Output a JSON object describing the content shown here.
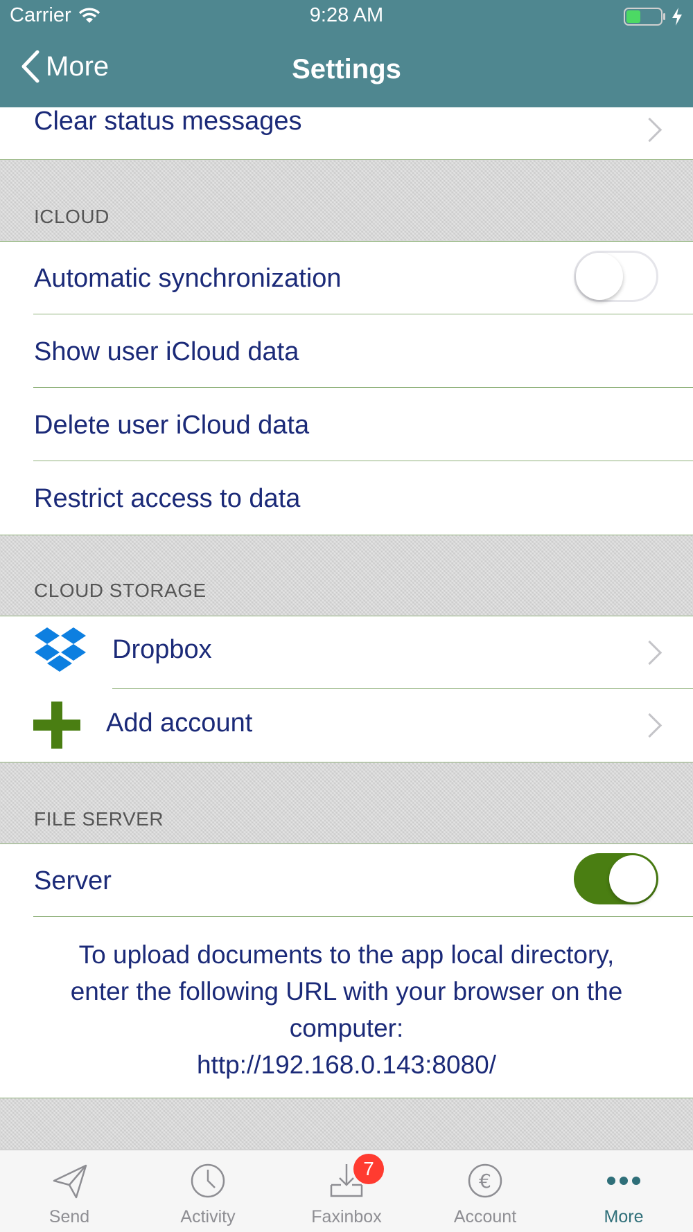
{
  "status_bar": {
    "carrier": "Carrier",
    "time": "9:28 AM"
  },
  "nav": {
    "back_label": "More",
    "title": "Settings"
  },
  "rows": {
    "clear_status": "Clear status messages"
  },
  "icloud": {
    "header": "ICLOUD",
    "auto_sync": {
      "label": "Automatic synchronization",
      "enabled": false
    },
    "show_data": "Show user iCloud data",
    "delete_data": "Delete user iCloud data",
    "restrict_access": "Restrict access to data"
  },
  "cloud_storage": {
    "header": "CLOUD STORAGE",
    "dropbox": "Dropbox",
    "add_account": "Add account"
  },
  "file_server": {
    "header": "FILE SERVER",
    "server": {
      "label": "Server",
      "enabled": true
    },
    "info_line1": "To upload documents to the app local directory,",
    "info_line2": "enter the following URL with your browser on the",
    "info_line3": "computer:",
    "url": "http://192.168.0.143:8080/"
  },
  "tabbar": {
    "send": "Send",
    "activity": "Activity",
    "faxinbox": "Faxinbox",
    "faxinbox_badge": "7",
    "account": "Account",
    "more": "More"
  },
  "colors": {
    "nav_bg": "#4f8790",
    "text": "#1b2a78",
    "toggle_on": "#4a7e12",
    "badge": "#ff3b30"
  }
}
